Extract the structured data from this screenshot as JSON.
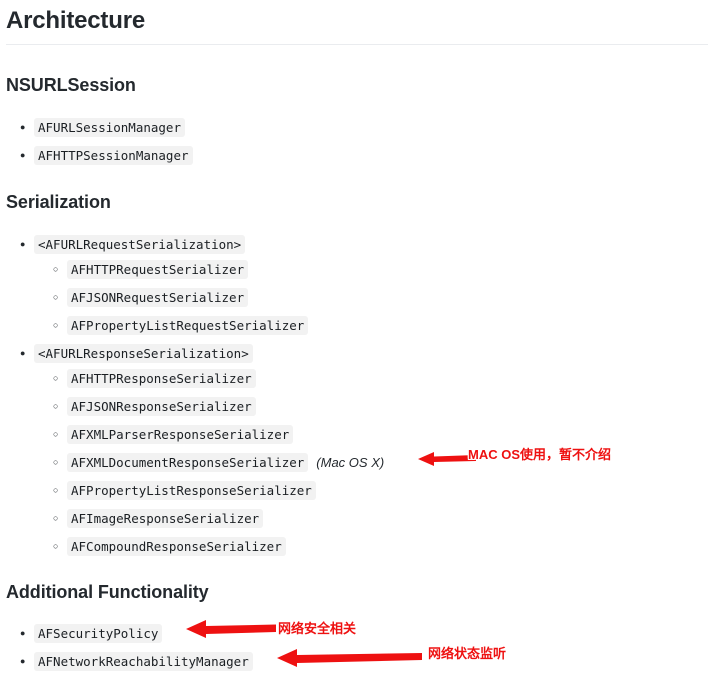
{
  "document": {
    "title": "Architecture"
  },
  "sections": [
    {
      "id": "nsurlsession",
      "heading": "NSURLSession",
      "items": [
        {
          "text": "AFURLSessionManager",
          "level": 1
        },
        {
          "text": "AFHTTPSessionManager",
          "level": 1
        }
      ]
    },
    {
      "id": "serialization",
      "heading": "Serialization",
      "items": [
        {
          "text": "<AFURLRequestSerialization>",
          "level": 1
        },
        {
          "text": "AFHTTPRequestSerializer",
          "level": 2
        },
        {
          "text": "AFJSONRequestSerializer",
          "level": 2
        },
        {
          "text": "AFPropertyListRequestSerializer",
          "level": 2
        },
        {
          "text": "<AFURLResponseSerialization>",
          "level": 1
        },
        {
          "text": "AFHTTPResponseSerializer",
          "level": 2
        },
        {
          "text": "AFJSONResponseSerializer",
          "level": 2
        },
        {
          "text": "AFXMLParserResponseSerializer",
          "level": 2
        },
        {
          "text": "AFXMLDocumentResponseSerializer",
          "level": 2,
          "note": "(Mac OS X)"
        },
        {
          "text": "AFPropertyListResponseSerializer",
          "level": 2
        },
        {
          "text": "AFImageResponseSerializer",
          "level": 2
        },
        {
          "text": "AFCompoundResponseSerializer",
          "level": 2
        }
      ]
    },
    {
      "id": "additional",
      "heading": "Additional Functionality",
      "items": [
        {
          "text": "AFSecurityPolicy",
          "level": 1
        },
        {
          "text": "AFNetworkReachabilityManager",
          "level": 1
        }
      ]
    }
  ],
  "annotations": {
    "macos": "MAC OS使用，暂不介绍",
    "security": "网络安全相关",
    "reachability": "网络状态监听"
  },
  "colors": {
    "annotation_red": "#ee1111",
    "code_background": "#f2f2f2",
    "text": "#24292e",
    "rule": "#eaecef"
  }
}
